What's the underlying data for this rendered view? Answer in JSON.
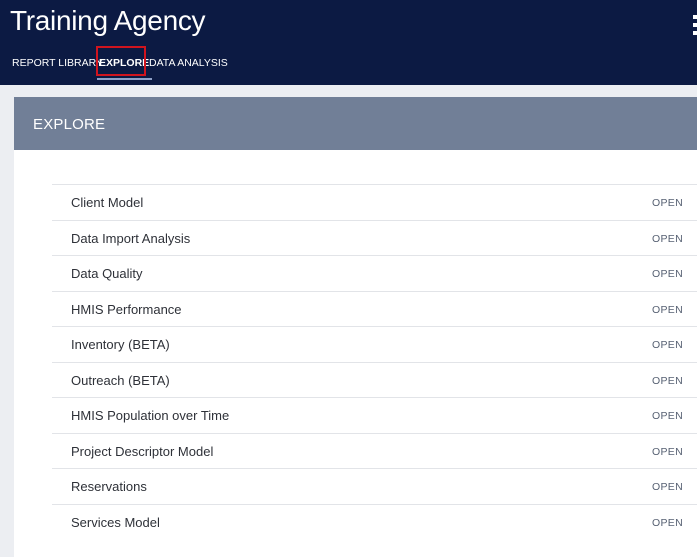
{
  "header": {
    "title": "Training Agency",
    "nav": {
      "report_library": "REPORT LIBRARY",
      "explore": "EXPLORE",
      "data_analysis": "DATA ANALYSIS"
    }
  },
  "card": {
    "title": "EXPLORE",
    "open_label": "OPEN",
    "items": [
      {
        "label": "Client Model"
      },
      {
        "label": "Data Import Analysis"
      },
      {
        "label": "Data Quality"
      },
      {
        "label": "HMIS Performance"
      },
      {
        "label": "Inventory (BETA)"
      },
      {
        "label": "Outreach (BETA)"
      },
      {
        "label": "HMIS Population over Time"
      },
      {
        "label": "Project Descriptor Model"
      },
      {
        "label": "Reservations"
      },
      {
        "label": "Services Model"
      }
    ]
  },
  "colors": {
    "header_bg": "#0c1a43",
    "card_header_bg": "#717f97",
    "highlight": "#d0141e"
  },
  "icons": {
    "menu": "hamburger-menu-icon"
  }
}
